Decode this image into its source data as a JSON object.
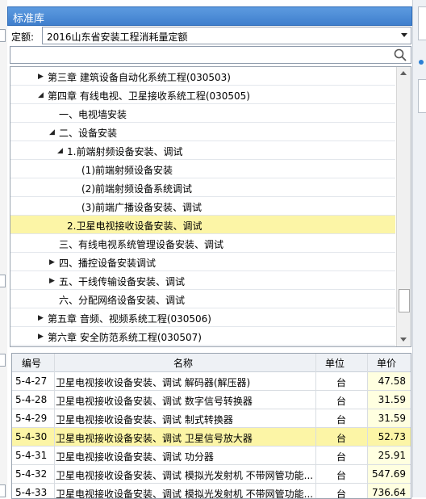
{
  "panel": {
    "title": "标准库"
  },
  "quota": {
    "label": "定额:",
    "selected": "2016山东省安装工程消耗量定额"
  },
  "search": {
    "placeholder": ""
  },
  "tree": [
    {
      "label": "第三章 建筑设备自动化系统工程(030503)",
      "indent": 1,
      "arrow": "collapsed"
    },
    {
      "label": "第四章 有线电视、卫星接收系统工程(030505)",
      "indent": 1,
      "arrow": "expanded"
    },
    {
      "label": "一、电视墙安装",
      "indent": 2,
      "arrow": "none"
    },
    {
      "label": "二、设备安装",
      "indent": 2,
      "arrow": "expanded"
    },
    {
      "label": "1.前端射频设备安装、调试",
      "indent": 3,
      "arrow": "expanded"
    },
    {
      "label": "(1)前端射频设备安装",
      "indent": 4,
      "arrow": "none"
    },
    {
      "label": "(2)前端射频设备系统调试",
      "indent": 4,
      "arrow": "none"
    },
    {
      "label": "(3)前端广播设备安装、调试",
      "indent": 4,
      "arrow": "none"
    },
    {
      "label": "2.卫星电视接收设备安装、调试",
      "indent": 3,
      "arrow": "none",
      "selected": true
    },
    {
      "label": "三、有线电视系统管理设备安装、调试",
      "indent": 2,
      "arrow": "none"
    },
    {
      "label": "四、播控设备安装调试",
      "indent": 2,
      "arrow": "collapsed"
    },
    {
      "label": "五、干线传输设备安装、调试",
      "indent": 2,
      "arrow": "collapsed"
    },
    {
      "label": "六、分配网络设备安装、调试",
      "indent": 2,
      "arrow": "none"
    },
    {
      "label": "第五章 音频、视频系统工程(030506)",
      "indent": 1,
      "arrow": "collapsed"
    },
    {
      "label": "第六章 安全防范系统工程(030507)",
      "indent": 1,
      "arrow": "collapsed"
    }
  ],
  "table": {
    "headers": {
      "code": "编号",
      "name": "名称",
      "unit": "单位",
      "price": "单价"
    },
    "rows": [
      {
        "code": "5-4-27",
        "name": "卫星电视接收设备安装、调试 解码器(解压器)",
        "unit": "台",
        "price": "47.58"
      },
      {
        "code": "5-4-28",
        "name": "卫星电视接收设备安装、调试 数字信号转换器",
        "unit": "台",
        "price": "31.59"
      },
      {
        "code": "5-4-29",
        "name": "卫星电视接收设备安装、调试 制式转换器",
        "unit": "台",
        "price": "31.59"
      },
      {
        "code": "5-4-30",
        "name": "卫星电视接收设备安装、调试 卫星信号放大器",
        "unit": "台",
        "price": "52.73",
        "selected": true
      },
      {
        "code": "5-4-31",
        "name": "卫星电视接收设备安装、调试 功分器",
        "unit": "台",
        "price": "25.91"
      },
      {
        "code": "5-4-32",
        "name": "卫星电视接收设备安装、调试 模拟光发射机 不带网管功能...",
        "unit": "台",
        "price": "547.69"
      },
      {
        "code": "5-4-33",
        "name": "卫星电视接收设备安装、调试 模拟光发射机 不带网管功能...",
        "unit": "台",
        "price": "736.64"
      }
    ]
  },
  "colors": {
    "selected_row": "#fcf5a6",
    "title_bar": "#4a8bd6",
    "price_cell": "#ffffe0"
  },
  "icons": {
    "search": "search-icon",
    "dropdown": "chevron-down-icon",
    "expand": "triangle-right-icon",
    "collapse": "triangle-down-icon"
  }
}
